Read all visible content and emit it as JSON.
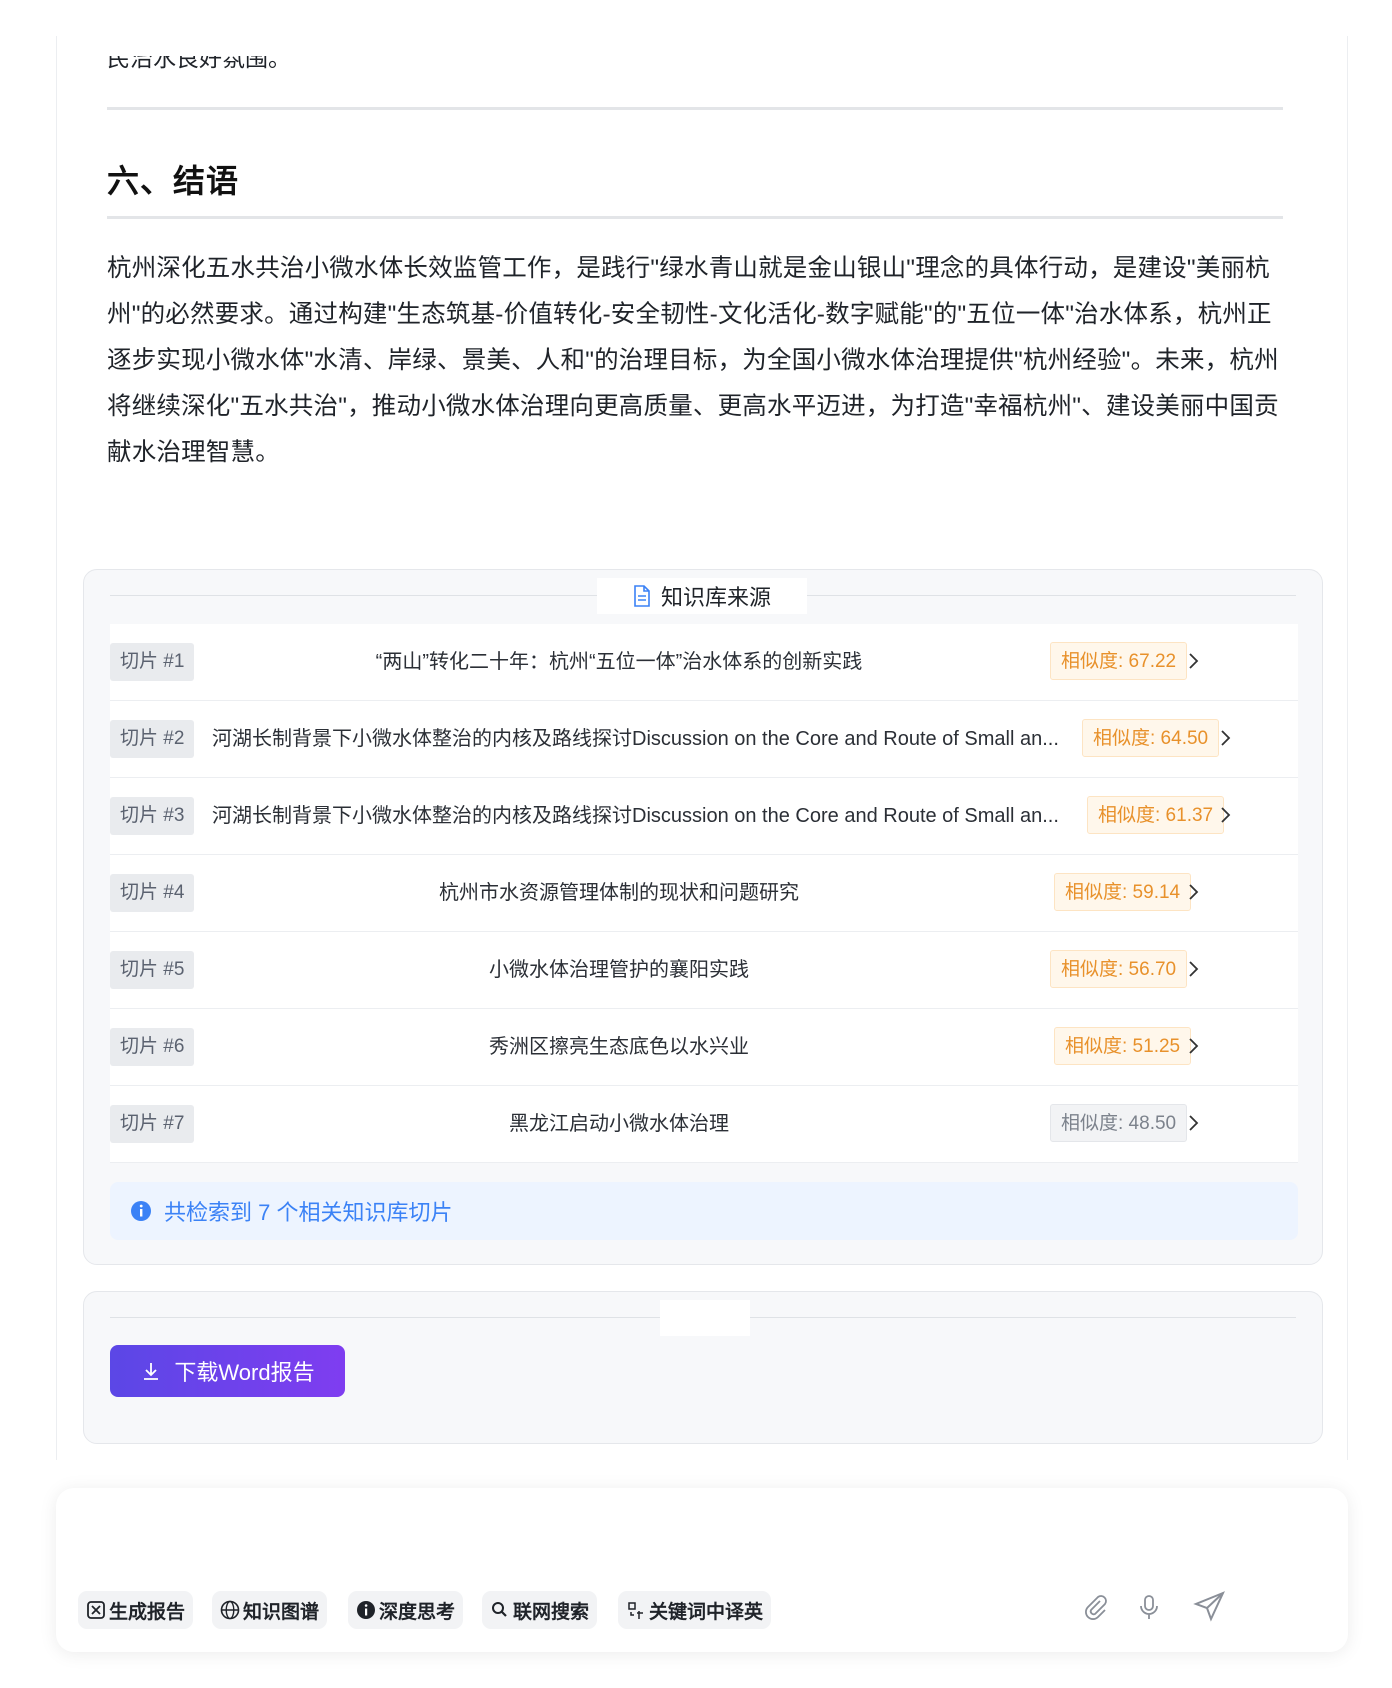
{
  "document": {
    "prev_fragment": "民治水良好氛围。",
    "heading": "六、结语",
    "paragraph": "杭州深化五水共治小微水体长效监管工作，是践行\"绿水青山就是金山银山\"理念的具体行动，是建设\"美丽杭州\"的必然要求。通过构建\"生态筑基-价值转化-安全韧性-文化活化-数字赋能\"的\"五位一体\"治水体系，杭州正逐步实现小微水体\"水清、岸绿、景美、人和\"的治理目标，为全国小微水体治理提供\"杭州经验\"。未来，杭州将继续深化\"五水共治\"，推动小微水体治理向更高质量、更高水平迈进，为打造\"幸福杭州\"、建设美丽中国贡献水治理智慧。"
  },
  "knowledge_base": {
    "title": "知识库来源",
    "items": [
      {
        "tag": "切片 #1",
        "title": "“两山”转化二十年：杭州“五位一体”治水体系的创新实践",
        "similarity": "相似度: 67.22",
        "level": "orange"
      },
      {
        "tag": "切片 #2",
        "title": "河湖长制背景下小微水体整治的内核及路线探讨Discussion on the Core and Route of Small an...",
        "similarity": "相似度: 64.50",
        "level": "orange"
      },
      {
        "tag": "切片 #3",
        "title": "河湖长制背景下小微水体整治的内核及路线探讨Discussion on the Core and Route of Small an...",
        "similarity": "相似度: 61.37",
        "level": "orange"
      },
      {
        "tag": "切片 #4",
        "title": "杭州市水资源管理体制的现状和问题研究",
        "similarity": "相似度: 59.14",
        "level": "orange"
      },
      {
        "tag": "切片 #5",
        "title": "小微水体治理管护的襄阳实践",
        "similarity": "相似度: 56.70",
        "level": "orange"
      },
      {
        "tag": "切片 #6",
        "title": "秀洲区擦亮生态底色以水兴业",
        "similarity": "相似度: 51.25",
        "level": "orange"
      },
      {
        "tag": "切片 #7",
        "title": "黑龙江启动小微水体治理",
        "similarity": "相似度: 48.50",
        "level": "gray"
      }
    ],
    "summary": "共检索到 7 个相关知识库切片"
  },
  "download": {
    "button_label": "下载Word报告"
  },
  "input_bar": {
    "chips": [
      {
        "label": "生成报告",
        "icon": "report-icon"
      },
      {
        "label": "知识图谱",
        "icon": "globe-icon"
      },
      {
        "label": "深度思考",
        "icon": "info-icon"
      },
      {
        "label": "联网搜索",
        "icon": "search-icon"
      },
      {
        "label": "关键词中译英",
        "icon": "translate-icon"
      }
    ],
    "tools": [
      "paperclip-icon",
      "microphone-icon",
      "send-icon"
    ]
  },
  "colors": {
    "accent_blue": "#3b82f6",
    "similarity_orange": "#e8912b",
    "button_gradient_start": "#5b47e6",
    "button_gradient_end": "#7f3df0"
  }
}
